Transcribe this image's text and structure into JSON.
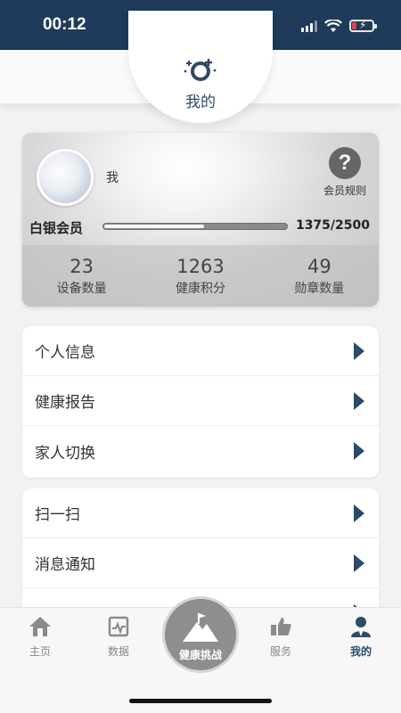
{
  "status_bar": {
    "time": "00:12"
  },
  "header": {
    "title": "我的"
  },
  "member_card": {
    "user_name": "我",
    "rules_label": "会员规则",
    "level": "白银会员",
    "progress_text": "1375/2500",
    "progress_fraction": 0.55,
    "stats": [
      {
        "value": "23",
        "label": "设备数量"
      },
      {
        "value": "1263",
        "label": "健康积分"
      },
      {
        "value": "49",
        "label": "勋章数量"
      }
    ]
  },
  "menu_group_1": [
    {
      "label": "个人信息"
    },
    {
      "label": "健康报告"
    },
    {
      "label": "家人切换"
    }
  ],
  "menu_group_2": [
    {
      "label": "扫一扫"
    },
    {
      "label": "消息通知"
    }
  ],
  "tabs": {
    "home": "主页",
    "data": "数据",
    "challenge": "健康挑战",
    "service": "服务",
    "mine": "我的"
  },
  "colors": {
    "primary": "#2e4a6a",
    "status_bar": "#1f3a5a",
    "inactive_tab": "#888888",
    "battery_low": "#e0424a"
  }
}
